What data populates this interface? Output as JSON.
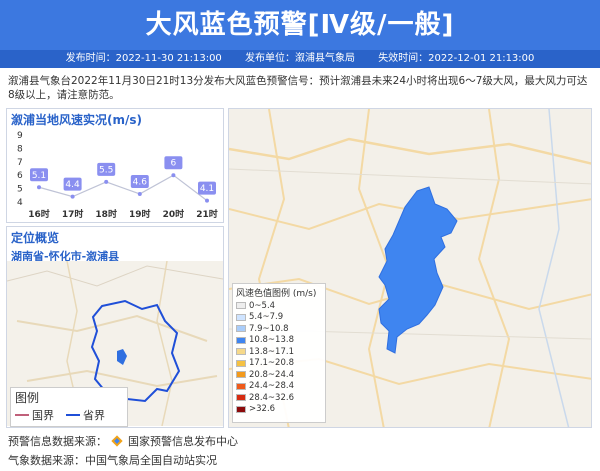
{
  "header": {
    "title": "大风蓝色预警[Ⅳ级/一般]",
    "publish_time": "发布时间：2022-11-30 21:13:00",
    "publisher": "发布单位：溆浦县气象局",
    "expire_time": "失效时间：2022-12-01 21:13:00"
  },
  "description": "溆浦县气象台2022年11月30日21时13分发布大风蓝色预警信号：预计溆浦县未来24小时将出现6～7级大风，最大风力可达8级以上，请注意防范。",
  "wind_panel": {
    "title": "溆浦当地风速实况(m/s)",
    "y_ticks": [
      "9",
      "8",
      "7",
      "6",
      "5",
      "4"
    ],
    "hours": [
      "16时",
      "17时",
      "18时",
      "19时",
      "20时",
      "21时"
    ],
    "values": [
      "5.1",
      "4.4",
      "5.5",
      "4.6",
      "6",
      "4.1"
    ]
  },
  "chart_data": {
    "type": "line",
    "title": "溆浦当地风速实况(m/s)",
    "categories": [
      "16时",
      "17时",
      "18时",
      "19时",
      "20时",
      "21时"
    ],
    "values": [
      5.1,
      4.4,
      5.5,
      4.6,
      6,
      4.1
    ],
    "ylim": [
      4,
      9
    ]
  },
  "location_panel": {
    "title": "定位概览",
    "subtitle": "湖南省-怀化市-溆浦县",
    "legend_title": "图例",
    "legend_national": "国界",
    "legend_province": "省界",
    "colors": {
      "national": "#c0607a",
      "province": "#1f4fd8"
    }
  },
  "wind_legend": {
    "title": "风速色值图例 (m/s)",
    "items": [
      {
        "label": "0~5.4",
        "color": "#eeeeee"
      },
      {
        "label": "5.4~7.9",
        "color": "#cfe4ff"
      },
      {
        "label": "7.9~10.8",
        "color": "#a9cdfa"
      },
      {
        "label": "10.8~13.8",
        "color": "#3f85f0"
      },
      {
        "label": "13.8~17.1",
        "color": "#f6d98a"
      },
      {
        "label": "17.1~20.8",
        "color": "#f5c142"
      },
      {
        "label": "20.8~24.4",
        "color": "#f39a1c"
      },
      {
        "label": "24.4~28.4",
        "color": "#ef5a1a"
      },
      {
        "label": "28.4~32.6",
        "color": "#d62b10"
      },
      {
        "label": ">32.6",
        "color": "#8c0b0b"
      }
    ]
  },
  "footer": {
    "warning_source": "预警信息数据来源：",
    "warning_source_name": "国家预警信息发布中心",
    "weather_source": "气象数据来源：中国气象局全国自动站实况"
  },
  "accent": "#3c78e0"
}
